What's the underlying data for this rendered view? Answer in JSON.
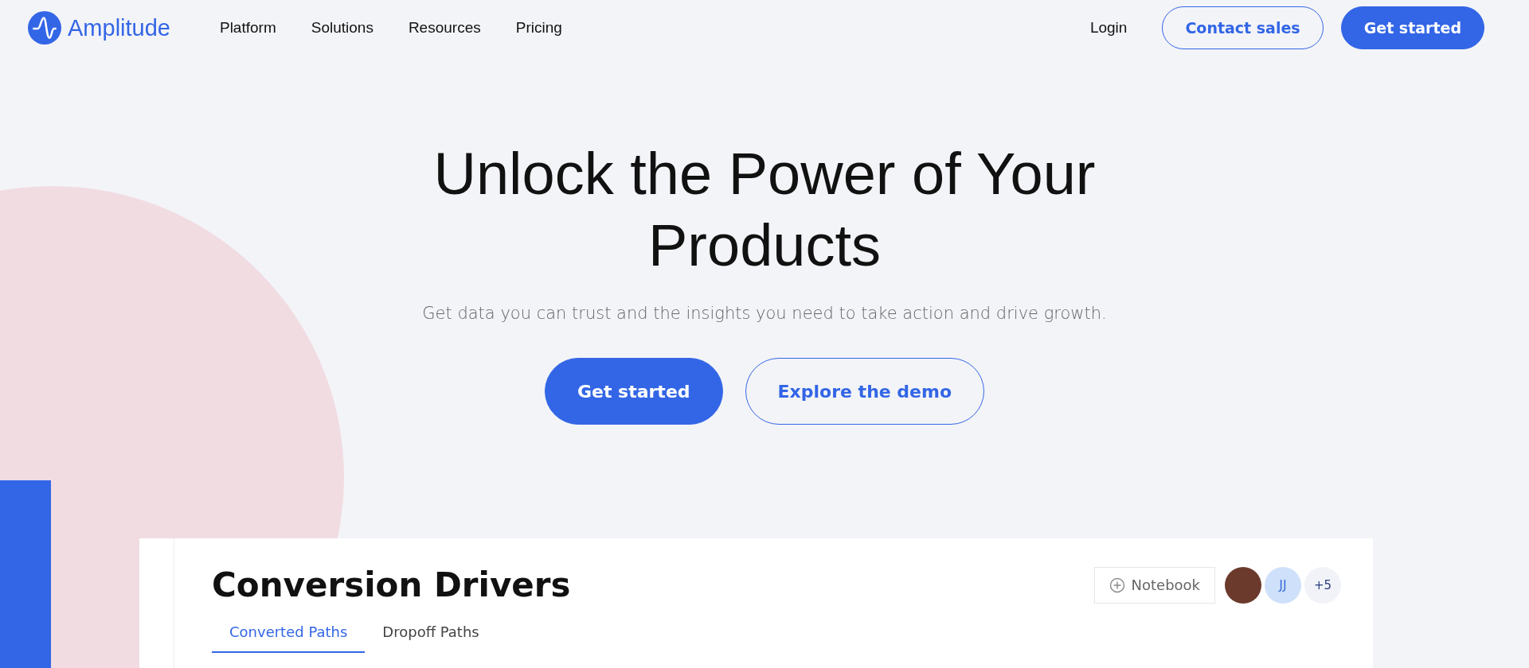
{
  "nav": {
    "brand": "Amplitude",
    "links": [
      "Platform",
      "Solutions",
      "Resources",
      "Pricing"
    ],
    "login": "Login",
    "contact": "Contact sales",
    "cta": "Get started"
  },
  "hero": {
    "title": "Unlock the Power of Your Products",
    "subtitle": "Get data you can trust and the insights you need to take action and drive growth.",
    "buttons": [
      {
        "label": "Get started",
        "kind": "primary"
      },
      {
        "label": "Explore the demo",
        "kind": "outline"
      }
    ]
  },
  "card": {
    "title": "Conversion Drivers",
    "notebook": "Notebook",
    "avatars": [
      {
        "kind": "photo"
      },
      {
        "kind": "initials",
        "text": "JJ"
      },
      {
        "kind": "count",
        "text": "+5"
      }
    ],
    "tabs": [
      {
        "label": "Converted Paths",
        "selected": true
      },
      {
        "label": "Dropoff Paths",
        "selected": false
      }
    ]
  }
}
